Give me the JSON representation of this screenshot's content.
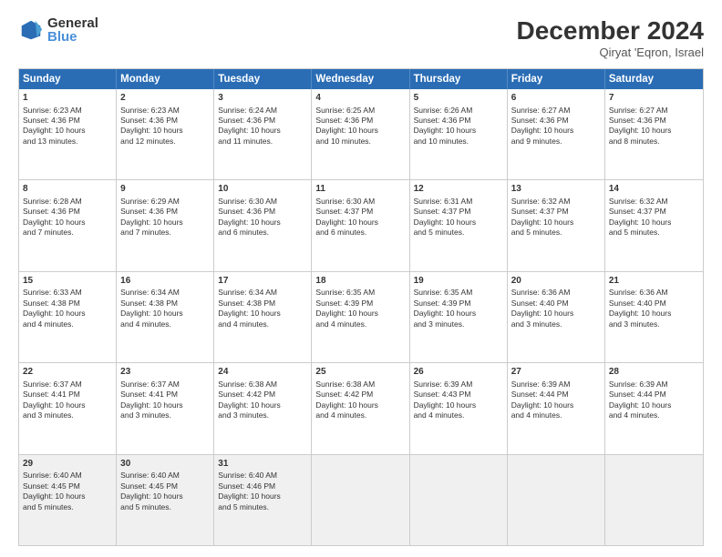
{
  "logo": {
    "general": "General",
    "blue": "Blue"
  },
  "header": {
    "month": "December 2024",
    "location": "Qiryat 'Eqron, Israel"
  },
  "weekdays": [
    "Sunday",
    "Monday",
    "Tuesday",
    "Wednesday",
    "Thursday",
    "Friday",
    "Saturday"
  ],
  "rows": [
    [
      {
        "day": "1",
        "info": "Sunrise: 6:23 AM\nSunset: 4:36 PM\nDaylight: 10 hours\nand 13 minutes."
      },
      {
        "day": "2",
        "info": "Sunrise: 6:23 AM\nSunset: 4:36 PM\nDaylight: 10 hours\nand 12 minutes."
      },
      {
        "day": "3",
        "info": "Sunrise: 6:24 AM\nSunset: 4:36 PM\nDaylight: 10 hours\nand 11 minutes."
      },
      {
        "day": "4",
        "info": "Sunrise: 6:25 AM\nSunset: 4:36 PM\nDaylight: 10 hours\nand 10 minutes."
      },
      {
        "day": "5",
        "info": "Sunrise: 6:26 AM\nSunset: 4:36 PM\nDaylight: 10 hours\nand 10 minutes."
      },
      {
        "day": "6",
        "info": "Sunrise: 6:27 AM\nSunset: 4:36 PM\nDaylight: 10 hours\nand 9 minutes."
      },
      {
        "day": "7",
        "info": "Sunrise: 6:27 AM\nSunset: 4:36 PM\nDaylight: 10 hours\nand 8 minutes."
      }
    ],
    [
      {
        "day": "8",
        "info": "Sunrise: 6:28 AM\nSunset: 4:36 PM\nDaylight: 10 hours\nand 7 minutes."
      },
      {
        "day": "9",
        "info": "Sunrise: 6:29 AM\nSunset: 4:36 PM\nDaylight: 10 hours\nand 7 minutes."
      },
      {
        "day": "10",
        "info": "Sunrise: 6:30 AM\nSunset: 4:36 PM\nDaylight: 10 hours\nand 6 minutes."
      },
      {
        "day": "11",
        "info": "Sunrise: 6:30 AM\nSunset: 4:37 PM\nDaylight: 10 hours\nand 6 minutes."
      },
      {
        "day": "12",
        "info": "Sunrise: 6:31 AM\nSunset: 4:37 PM\nDaylight: 10 hours\nand 5 minutes."
      },
      {
        "day": "13",
        "info": "Sunrise: 6:32 AM\nSunset: 4:37 PM\nDaylight: 10 hours\nand 5 minutes."
      },
      {
        "day": "14",
        "info": "Sunrise: 6:32 AM\nSunset: 4:37 PM\nDaylight: 10 hours\nand 5 minutes."
      }
    ],
    [
      {
        "day": "15",
        "info": "Sunrise: 6:33 AM\nSunset: 4:38 PM\nDaylight: 10 hours\nand 4 minutes."
      },
      {
        "day": "16",
        "info": "Sunrise: 6:34 AM\nSunset: 4:38 PM\nDaylight: 10 hours\nand 4 minutes."
      },
      {
        "day": "17",
        "info": "Sunrise: 6:34 AM\nSunset: 4:38 PM\nDaylight: 10 hours\nand 4 minutes."
      },
      {
        "day": "18",
        "info": "Sunrise: 6:35 AM\nSunset: 4:39 PM\nDaylight: 10 hours\nand 4 minutes."
      },
      {
        "day": "19",
        "info": "Sunrise: 6:35 AM\nSunset: 4:39 PM\nDaylight: 10 hours\nand 3 minutes."
      },
      {
        "day": "20",
        "info": "Sunrise: 6:36 AM\nSunset: 4:40 PM\nDaylight: 10 hours\nand 3 minutes."
      },
      {
        "day": "21",
        "info": "Sunrise: 6:36 AM\nSunset: 4:40 PM\nDaylight: 10 hours\nand 3 minutes."
      }
    ],
    [
      {
        "day": "22",
        "info": "Sunrise: 6:37 AM\nSunset: 4:41 PM\nDaylight: 10 hours\nand 3 minutes."
      },
      {
        "day": "23",
        "info": "Sunrise: 6:37 AM\nSunset: 4:41 PM\nDaylight: 10 hours\nand 3 minutes."
      },
      {
        "day": "24",
        "info": "Sunrise: 6:38 AM\nSunset: 4:42 PM\nDaylight: 10 hours\nand 3 minutes."
      },
      {
        "day": "25",
        "info": "Sunrise: 6:38 AM\nSunset: 4:42 PM\nDaylight: 10 hours\nand 4 minutes."
      },
      {
        "day": "26",
        "info": "Sunrise: 6:39 AM\nSunset: 4:43 PM\nDaylight: 10 hours\nand 4 minutes."
      },
      {
        "day": "27",
        "info": "Sunrise: 6:39 AM\nSunset: 4:44 PM\nDaylight: 10 hours\nand 4 minutes."
      },
      {
        "day": "28",
        "info": "Sunrise: 6:39 AM\nSunset: 4:44 PM\nDaylight: 10 hours\nand 4 minutes."
      }
    ],
    [
      {
        "day": "29",
        "info": "Sunrise: 6:40 AM\nSunset: 4:45 PM\nDaylight: 10 hours\nand 5 minutes."
      },
      {
        "day": "30",
        "info": "Sunrise: 6:40 AM\nSunset: 4:45 PM\nDaylight: 10 hours\nand 5 minutes."
      },
      {
        "day": "31",
        "info": "Sunrise: 6:40 AM\nSunset: 4:46 PM\nDaylight: 10 hours\nand 5 minutes."
      },
      {
        "day": "",
        "info": ""
      },
      {
        "day": "",
        "info": ""
      },
      {
        "day": "",
        "info": ""
      },
      {
        "day": "",
        "info": ""
      }
    ]
  ]
}
